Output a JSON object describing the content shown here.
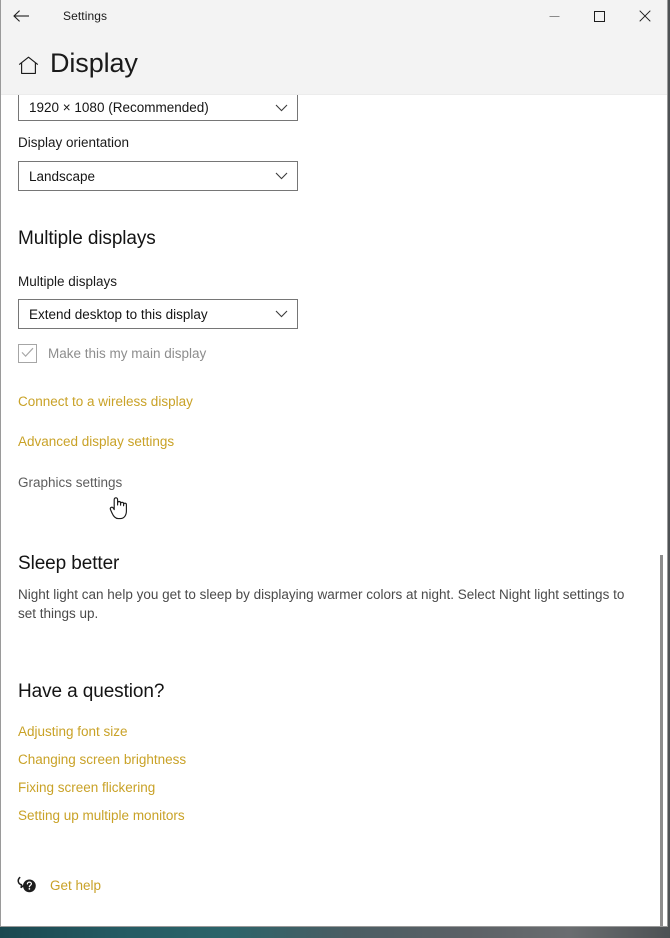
{
  "window": {
    "titlebar": {
      "back_label": "Back",
      "title": "Settings",
      "minimize_label": "Minimize",
      "maximize_label": "Maximize",
      "close_label": "Close"
    },
    "header": {
      "home_icon": "home-icon",
      "page_title": "Display"
    }
  },
  "content": {
    "resolution": {
      "value": "1920 × 1080 (Recommended)",
      "chevron_icon": "chevron-down-icon"
    },
    "orientation": {
      "label": "Display orientation",
      "value": "Landscape",
      "chevron_icon": "chevron-down-icon"
    },
    "multiple_displays": {
      "heading": "Multiple displays",
      "label": "Multiple displays",
      "value": "Extend desktop to this display",
      "chevron_icon": "chevron-down-icon",
      "checkbox": {
        "label": "Make this my main display",
        "checked": true,
        "disabled": true,
        "check_icon": "check-icon"
      },
      "links": [
        {
          "label": "Connect to a wireless display",
          "state": "normal"
        },
        {
          "label": "Advanced display settings",
          "state": "normal"
        },
        {
          "label": "Graphics settings",
          "state": "hovered"
        }
      ]
    },
    "sleep_better": {
      "heading": "Sleep better",
      "text": "Night light can help you get to sleep by displaying warmer colors at night. Select Night light settings to set things up."
    },
    "have_a_question": {
      "heading": "Have a question?",
      "links": [
        "Adjusting font size",
        "Changing screen brightness",
        "Fixing screen flickering",
        "Setting up multiple monitors"
      ]
    },
    "get_help": {
      "icon": "help-chat-icon",
      "label": "Get help"
    },
    "scrollbar": {
      "name": "vertical-scrollbar"
    },
    "cursor": {
      "name": "hand-pointer-cursor"
    }
  },
  "colors": {
    "link_accent": "#c9a227",
    "header_bg": "#f3f3f3",
    "window_bg": "#ffffff",
    "disabled_text": "#8d8d8d"
  }
}
